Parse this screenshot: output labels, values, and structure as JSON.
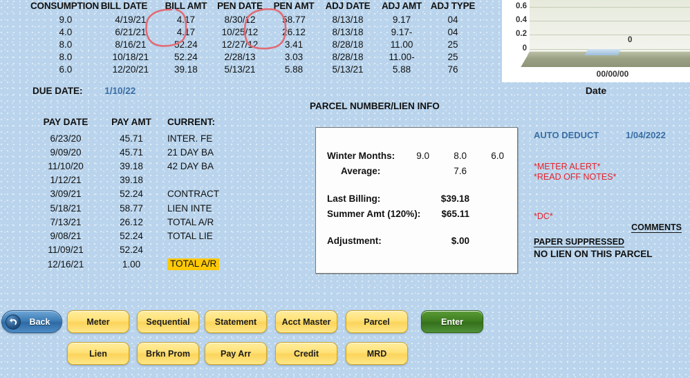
{
  "top_table": {
    "headers": [
      "CONSUMPTION",
      "BILL DATE",
      "BILL AMT",
      "PEN DATE",
      "PEN AMT",
      "ADJ DATE",
      "ADJ AMT",
      "ADJ TYPE"
    ],
    "rows": [
      [
        "9.0",
        "4/19/21",
        "4.17",
        "8/30/12",
        "58.77",
        "8/13/18",
        "9.17",
        "04"
      ],
      [
        "4.0",
        "6/21/21",
        "4.17",
        "10/25/12",
        "26.12",
        "8/13/18",
        "9.17-",
        "04"
      ],
      [
        "8.0",
        "8/16/21",
        "52.24",
        "12/27/12",
        "3.41",
        "8/28/18",
        "11.00",
        "25"
      ],
      [
        "8.0",
        "10/18/21",
        "52.24",
        "2/28/13",
        "3.03",
        "8/28/18",
        "11.00-",
        "25"
      ],
      [
        "6.0",
        "12/20/21",
        "39.18",
        "5/13/21",
        "5.88",
        "5/13/21",
        "5.88",
        "76"
      ]
    ]
  },
  "due_date": {
    "label": "DUE DATE:",
    "value": "1/10/22"
  },
  "pay_table": {
    "headers": [
      "PAY DATE",
      "PAY AMT",
      "CURRENT:"
    ],
    "rows": [
      [
        "6/23/20",
        "45.71",
        "INTER. FE"
      ],
      [
        "9/09/20",
        "45.71",
        "21 DAY BA"
      ],
      [
        "11/10/20",
        "39.18",
        "42 DAY BA"
      ],
      [
        "1/12/21",
        "39.18",
        ""
      ],
      [
        "3/09/21",
        "52.24",
        "CONTRACT"
      ],
      [
        "5/18/21",
        "58.77",
        "LIEN INTE"
      ],
      [
        "7/13/21",
        "26.12",
        "TOTAL A/R"
      ],
      [
        "9/08/21",
        "52.24",
        "TOTAL LIE"
      ],
      [
        "11/09/21",
        "52.24",
        ""
      ],
      [
        "12/16/21",
        "1.00",
        "TOTAL A/R"
      ]
    ],
    "highlight_last_label": "TOTAL A/R"
  },
  "parcel": {
    "section_label": "PARCEL NUMBER/LIEN INFO",
    "winter_months_label": "Winter Months:",
    "winter_months": [
      "9.0",
      "8.0",
      "6.0"
    ],
    "average_label": "Average:",
    "average": "7.6",
    "last_billing_label": "Last Billing:",
    "last_billing": "$39.18",
    "summer_amt_label": "Summer Amt (120%):",
    "summer_amt": "$65.11",
    "adjustment_label": "Adjustment:",
    "adjustment": "$.00"
  },
  "notes": {
    "auto_deduct_label": "AUTO DEDUCT",
    "auto_deduct_date": "1/04/2022",
    "meter_alert": "*METER ALERT*",
    "read_off_notes": "*READ OFF NOTES*",
    "dc": "*DC*",
    "comments": "COMMENTS",
    "paper_suppressed": "PAPER SUPPRESSED",
    "no_lien": "NO LIEN ON THIS PARCEL"
  },
  "chart_data": {
    "type": "bar",
    "title": "",
    "xlabel": "Date",
    "ylabel": "",
    "categories": [
      "00/00/00"
    ],
    "values": [
      0
    ],
    "data_labels": [
      "0"
    ],
    "yticks": [
      "0.6",
      "0.4",
      "0.2",
      "0"
    ],
    "ylim": [
      0,
      0.7
    ],
    "grid": true,
    "legend": "none",
    "axis_title": "Date"
  },
  "buttons": {
    "back": "Back",
    "row1": [
      "Meter",
      "Sequential",
      "Statement",
      "Acct Master",
      "Parcel"
    ],
    "enter": "Enter",
    "row2": [
      "Lien",
      "Brkn Prom",
      "Pay Arr",
      "Credit",
      "MRD"
    ]
  },
  "colors": {
    "background": "#b9d4ec",
    "accent_blue": "#3a6ea5",
    "alert_red": "#e8222a",
    "highlight_yellow": "#ffc907",
    "button_yellow": "#ffe175",
    "enter_green": "#3f7f22",
    "annotation_red": "#e26b74"
  }
}
